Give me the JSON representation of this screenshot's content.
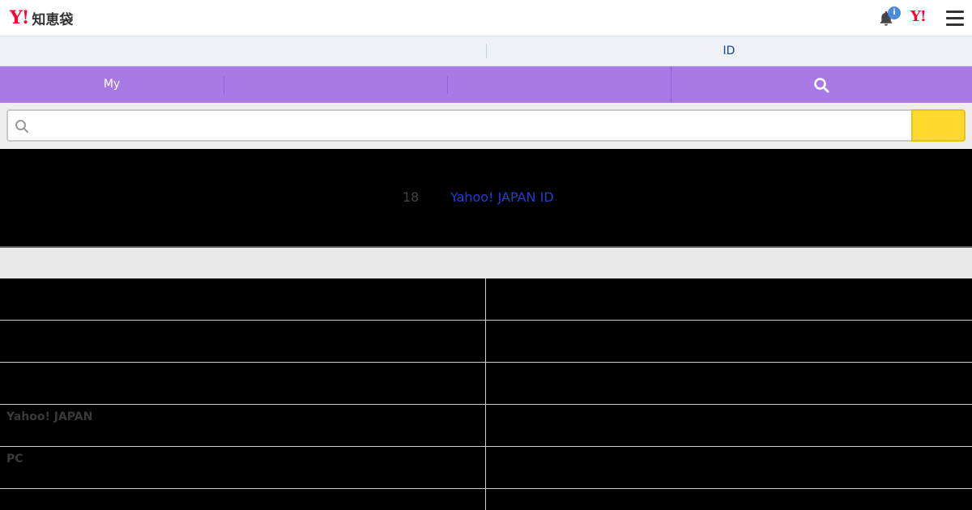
{
  "header": {
    "logo_mark": "Y!",
    "logo_text": "知恵袋",
    "notification_badge": "i",
    "yahoo_mark": "Y!"
  },
  "subbar": {
    "login_label": "ID"
  },
  "nav": {
    "items": [
      {
        "label": "My"
      },
      {
        "label": ""
      },
      {
        "label": ""
      }
    ]
  },
  "search": {
    "value": "",
    "placeholder": ""
  },
  "notice": {
    "age_text": "18",
    "link_text": "Yahoo! JAPAN ID"
  },
  "grid": {
    "rows": [
      {
        "left": "",
        "right": ""
      },
      {
        "left": "",
        "right": ""
      },
      {
        "left": "",
        "right": ""
      },
      {
        "left": "Yahoo! JAPAN",
        "right": ""
      },
      {
        "left": "PC",
        "right": ""
      },
      {
        "left": "",
        "right": ""
      }
    ]
  },
  "colors": {
    "nav_bg": "#a97ae6",
    "search_button": "#ffd92e",
    "brand_red": "#ff0033",
    "link_blue": "#1f3fd6"
  }
}
